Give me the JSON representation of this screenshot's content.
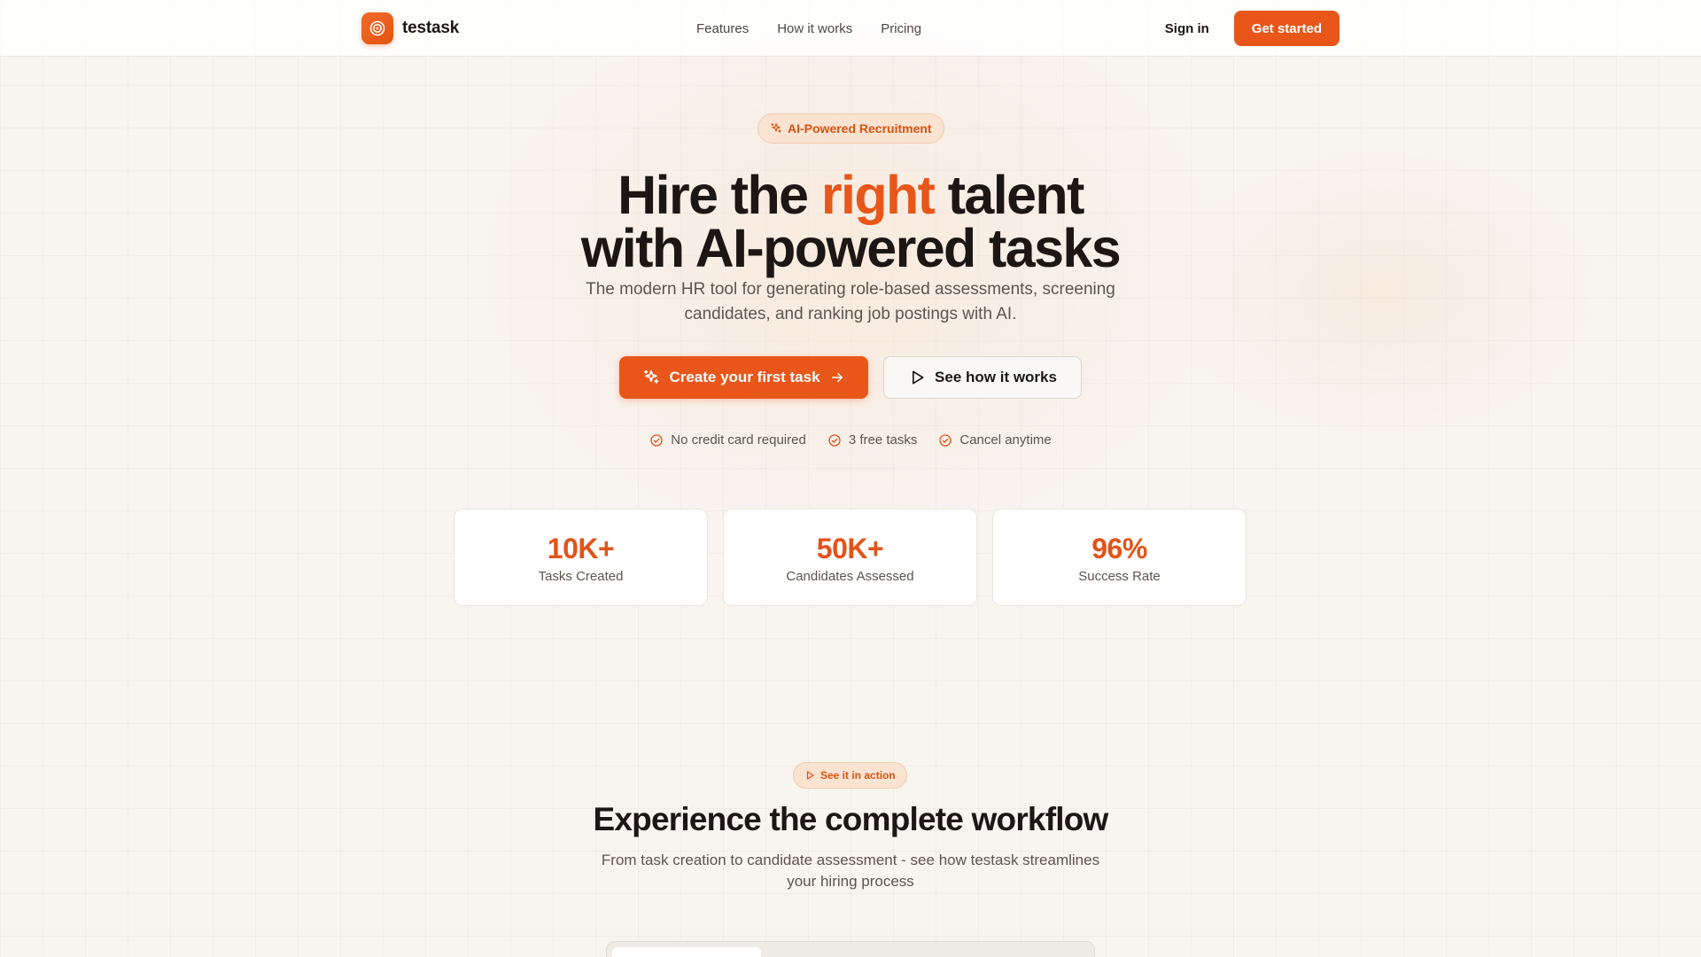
{
  "nav": {
    "brand": "testask",
    "links": [
      "Features",
      "How it works",
      "Pricing"
    ],
    "signin": "Sign in",
    "get_started": "Get started"
  },
  "hero": {
    "badge": "AI-Powered Recruitment",
    "title_part1": "Hire the ",
    "title_accent": "right",
    "title_part2": " talent",
    "title_line2": "with AI-powered tasks",
    "subtitle": "The modern HR tool for generating role-based assessments, screening candidates, and ranking job postings with AI.",
    "cta_primary": "Create your first task",
    "cta_secondary": "See how it works",
    "checks": [
      "No credit card required",
      "3 free tasks",
      "Cancel anytime"
    ]
  },
  "stats": [
    {
      "value": "10K+",
      "label": "Tasks Created"
    },
    {
      "value": "50K+",
      "label": "Candidates Assessed"
    },
    {
      "value": "96%",
      "label": "Success Rate"
    }
  ],
  "workflow": {
    "badge": "See it in action",
    "title": "Experience the complete workflow",
    "subtitle": "From task creation to candidate assessment - see how testask streamlines your hiring process"
  },
  "colors": {
    "accent": "#e8561a",
    "badge_bg": "#fbe3d2",
    "text_dark": "#1c1714",
    "text_muted": "#5c554f"
  }
}
